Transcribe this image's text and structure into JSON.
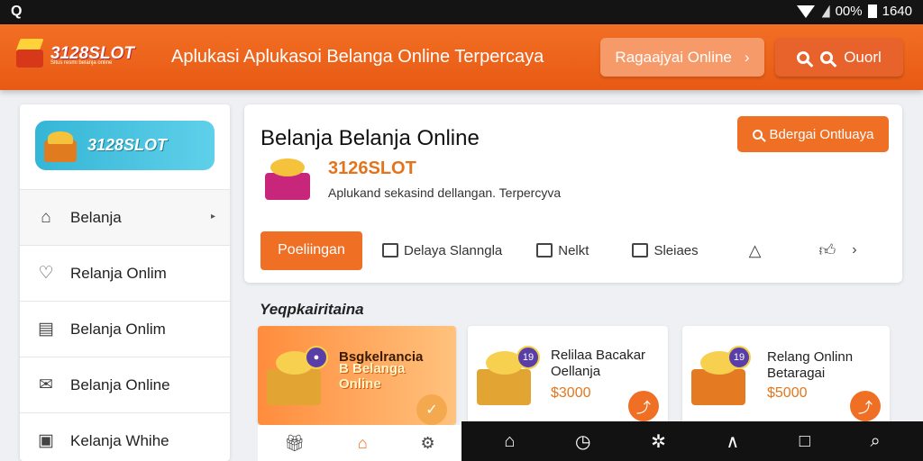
{
  "status_bar": {
    "left_icon": "Q",
    "battery": "00%",
    "time": "1640"
  },
  "header": {
    "brand_name": "3128SLOT",
    "brand_tagline": "Situs resmi belanja online",
    "title": "Aplukasi Aplukasoi Belanga Online Terpercaya",
    "online_button_label": "Ragaajyai Online",
    "search_button_label": "Ouorl"
  },
  "sidebar": {
    "logo_text": "3128SLOT",
    "items": [
      {
        "label": "Belanja",
        "icon": "home-icon"
      },
      {
        "label": "Relanja Onlim",
        "icon": "heart-pin-icon"
      },
      {
        "label": "Belanja Onlim",
        "icon": "receipt-icon"
      },
      {
        "label": "Belanja Online",
        "icon": "mail-check-icon"
      },
      {
        "label": "Kelanja Whihe",
        "icon": "bag-icon"
      }
    ]
  },
  "main_card": {
    "title": "Belanja Belanja Online",
    "action_button_label": "Bdergai Ontluaya",
    "brand": "3126SLOT",
    "description": "Aplukand sekasind dellangan.  Terpercyva",
    "tabs": {
      "primary": "Poeliingan",
      "items": [
        {
          "label": "Delaya Slanngla",
          "icon": "tray-icon"
        },
        {
          "label": "Nelkt",
          "icon": "film-icon"
        },
        {
          "label": "Sleiaes",
          "icon": "list-icon"
        }
      ]
    }
  },
  "section": {
    "title": "Yeqpkairitaina",
    "products": [
      {
        "title": "Bsgkelrancia",
        "promo": "B Belanga\nOnline"
      },
      {
        "badge": "19",
        "title": "Relilaa Bacakar\nOellanja",
        "price": "$3000"
      },
      {
        "badge": "19",
        "title": "Relang Onlinn\nBetaragai",
        "price": "$5000"
      }
    ]
  },
  "colors": {
    "accent": "#ef6f25",
    "header": "#f26f24",
    "sidebar_logo": "#35b6d6"
  }
}
